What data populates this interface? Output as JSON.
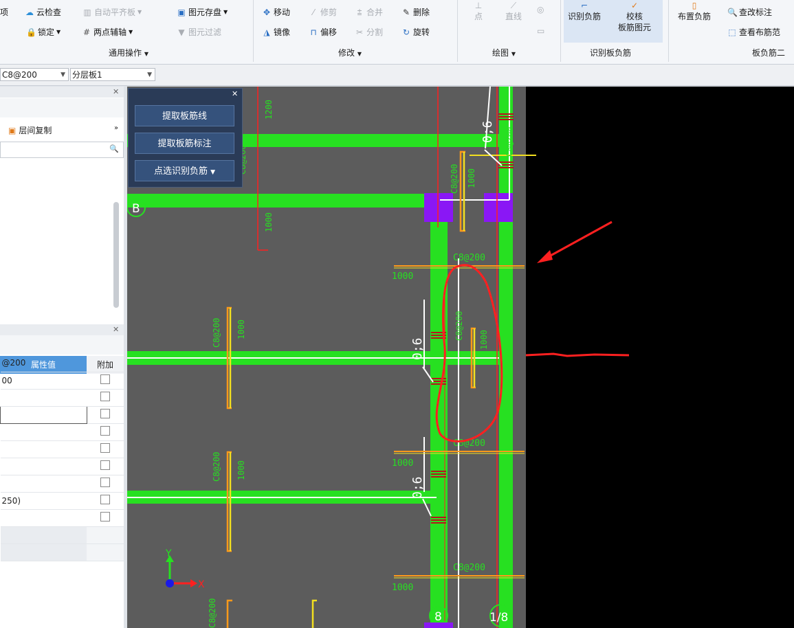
{
  "ribbon": {
    "items": {
      "cloud_check": "云检查",
      "auto_align": "自动平齐板",
      "save_element": "图元存盘",
      "move": "移动",
      "trim": "修剪",
      "merge": "合并",
      "delete": "删除",
      "lock": "锁定",
      "two_point_axis": "两点辅轴",
      "element_filter": "图元过滤",
      "mirror": "镜像",
      "offset": "偏移",
      "split": "分割",
      "rotate": "旋转",
      "point": "点",
      "line": "直线",
      "identify_neg_rebar": "识别负筋",
      "check": "校核",
      "check_sub": "板筋图元",
      "place_neg_rebar": "布置负筋",
      "edit_annotation": "查改标注",
      "view_rebar_range": "查看布筋范",
      "left_cut": "项"
    },
    "groups": {
      "common": "通用操作",
      "modify": "修改",
      "draw": "绘图",
      "identify": "识别板负筋",
      "slab_neg": "板负筋二"
    }
  },
  "toolbar": {
    "rebar_combo": "C8@200",
    "layer_combo": "分层板1"
  },
  "left_panel": {
    "copy_between_floors": "层间复制",
    "prop_header_value": "属性值",
    "prop_header_extra": "附加",
    "rows": [
      "@200",
      "00",
      "",
      "",
      "",
      "",
      "",
      "",
      "250)",
      "",
      "",
      ""
    ]
  },
  "float_panel": {
    "extract_lines": "提取板筋线",
    "extract_labels": "提取板筋标注",
    "pick_identify": "点选识别负筋"
  },
  "cad": {
    "axis_b": "B",
    "axis_8": "8",
    "axis_1_8": "1/8",
    "dim_1200": "1200",
    "dim_1000": "1000",
    "rebar_c8_200": "C8@200",
    "rebar_06": "0;6",
    "axis_x": "X",
    "axis_y": "Y"
  },
  "colors": {
    "cad_bg": "#5c5c5c",
    "beam": "#27e021",
    "column": "#8a17f5",
    "rebar_yellow": "#f3e01f",
    "annotation_red": "#ff2020",
    "panel_blue": "#2a3b57",
    "table_header": "#4f97dc"
  }
}
